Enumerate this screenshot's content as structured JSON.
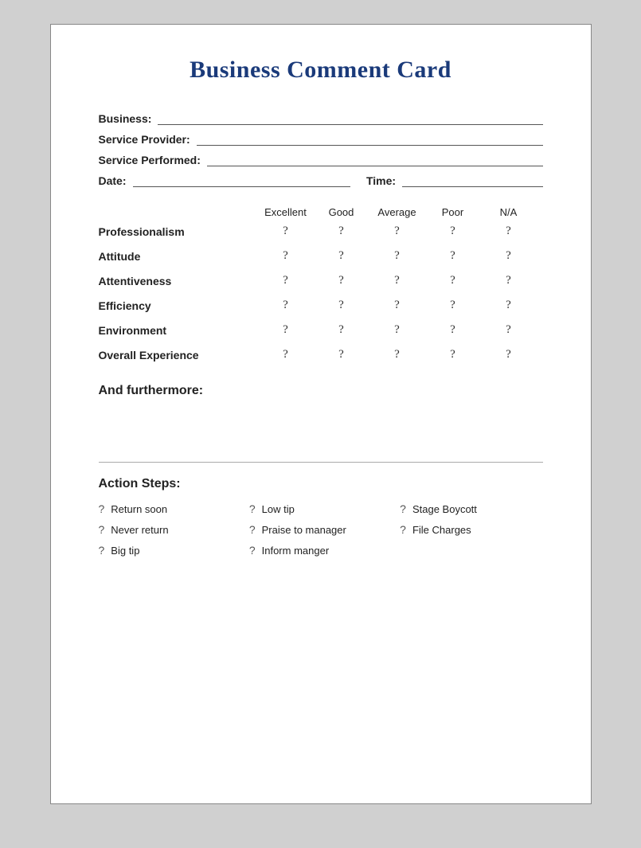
{
  "card": {
    "title": "Business Comment Card",
    "fields": [
      {
        "label": "Business:",
        "id": "business"
      },
      {
        "label": "Service Provider:",
        "id": "service-provider"
      },
      {
        "label": "Service Performed:",
        "id": "service-performed"
      }
    ],
    "date_label": "Date:",
    "time_label": "Time:",
    "rating_headers": [
      "Excellent",
      "Good",
      "Average",
      "Poor",
      "N/A"
    ],
    "rating_rows": [
      {
        "label": "Professionalism"
      },
      {
        "label": "Attitude"
      },
      {
        "label": "Attentiveness"
      },
      {
        "label": "Efficiency"
      },
      {
        "label": "Environment"
      },
      {
        "label": "Overall Experience"
      }
    ],
    "furthermore_title": "And furthermore:",
    "action_steps_title": "Action Steps:",
    "action_items": [
      {
        "icon": "?",
        "text": "Return soon"
      },
      {
        "icon": "?",
        "text": "Never return"
      },
      {
        "icon": "?",
        "text": "Big tip"
      },
      {
        "icon": "?",
        "text": "Low tip"
      },
      {
        "icon": "?",
        "text": "Praise to manager"
      },
      {
        "icon": "?",
        "text": "Inform manger"
      },
      {
        "icon": "?",
        "text": "Stage Boycott"
      },
      {
        "icon": "?",
        "text": "File Charges"
      },
      {
        "icon": "",
        "text": ""
      }
    ],
    "rating_icon": "?"
  }
}
